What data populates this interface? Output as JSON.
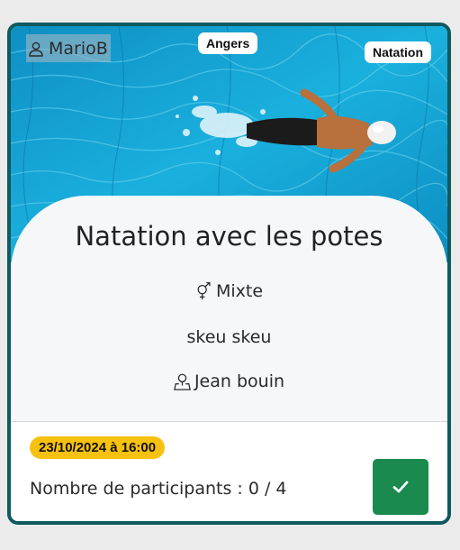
{
  "card": {
    "author": "MarioB",
    "city": "Angers",
    "sport": "Natation",
    "title": "Natation avec les potes",
    "gender": "Mixte",
    "description": "skeu skeu",
    "location": "Jean bouin",
    "datetime": "23/10/2024 à 16:00",
    "participants_label": "Nombre de participants : 0 / 4"
  },
  "colors": {
    "border": "#0e5a5f",
    "date_badge": "#f7c10f",
    "join_button": "#1a8a4e",
    "water": "#1aa8d8"
  },
  "icons": {
    "author": "user-icon",
    "gender": "gender-icon",
    "location": "map-pin-icon",
    "join": "check-icon"
  }
}
